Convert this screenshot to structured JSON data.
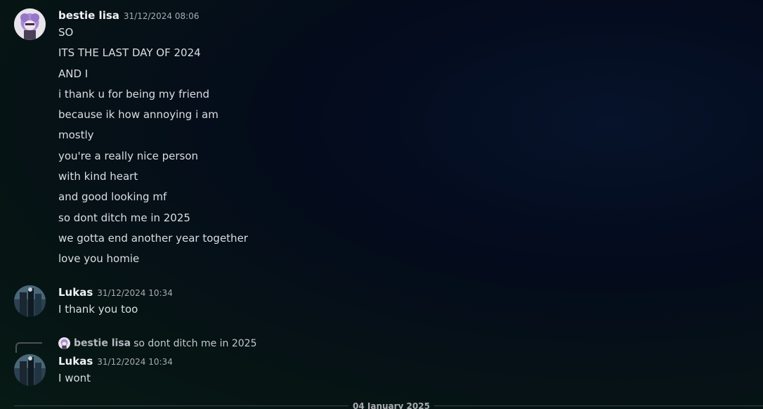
{
  "messages": [
    {
      "author": "bestie lisa",
      "timestamp": "31/12/2024 08:06",
      "avatar_icon": "lisa-avatar-icon",
      "lines": [
        "SO",
        "ITS THE LAST DAY OF 2024",
        "AND I",
        "i thank u for being my friend",
        "because ik how annoying i am",
        "mostly",
        "you're a really nice person",
        "with kind heart",
        "and good looking mf",
        "so dont ditch me in 2025",
        "we gotta end another year together",
        "love you homie"
      ]
    },
    {
      "author": "Lukas",
      "timestamp": "31/12/2024 10:34",
      "avatar_icon": "lukas-avatar-icon",
      "lines": [
        "I thank you too"
      ]
    },
    {
      "author": "Lukas",
      "timestamp": "31/12/2024 10:34",
      "avatar_icon": "lukas-avatar-icon",
      "reply": {
        "author": "bestie lisa",
        "text": "so dont ditch me in 2025"
      },
      "lines": [
        "I wont"
      ]
    }
  ],
  "date_divider": "04 January 2025",
  "colors": {
    "author": "#f2f3f5",
    "message_text": "#dbdee1",
    "timestamp": "#a8abb3",
    "lisa_avatar": "#9b7ec8"
  }
}
